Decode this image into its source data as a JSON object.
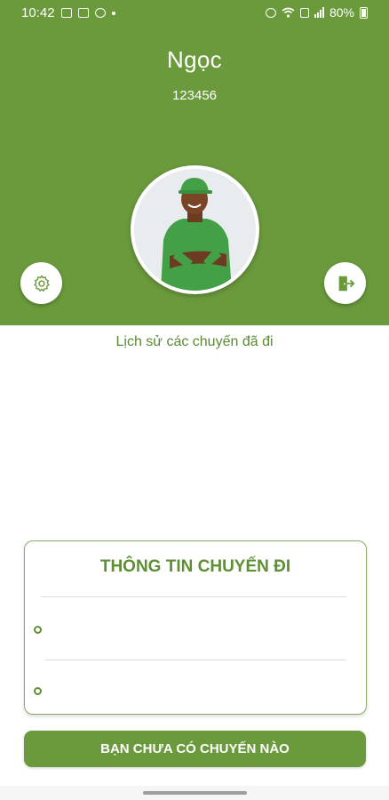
{
  "status_bar": {
    "time": "10:42",
    "battery": "80%",
    "icons_left": [
      "image-icon",
      "voicemail-icon",
      "messenger-icon",
      "dot-icon"
    ],
    "icons_right": [
      "alarm-icon",
      "wifi-icon",
      "lte-icon",
      "signal-icon",
      "battery-icon"
    ]
  },
  "profile": {
    "name": "Ngọc",
    "id": "123456"
  },
  "history": {
    "label": "Lịch sử các chuyến đã đi"
  },
  "trip_info": {
    "title": "THÔNG TIN CHUYẾN ĐI"
  },
  "actions": {
    "no_trip_label": "BẠN CHƯA CÓ CHUYẾN NÀO"
  },
  "colors": {
    "primary": "#6b9a3d",
    "accent_text": "#5f8f35"
  }
}
